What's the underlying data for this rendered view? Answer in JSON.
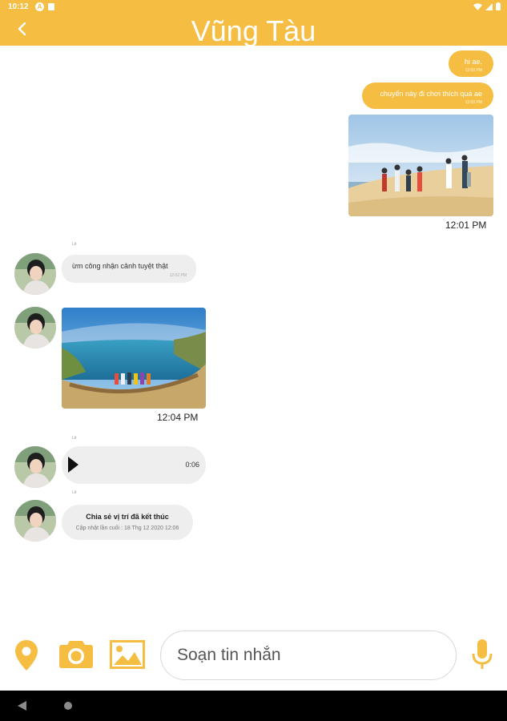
{
  "status_bar": {
    "time": "10:12",
    "left_icon_letter": "A"
  },
  "header": {
    "title": "Vũng Tàu",
    "background_color": "#f5bd41"
  },
  "messages": [
    {
      "type": "outgoing-text",
      "text": "hi ae.",
      "time": "12:00 PM"
    },
    {
      "type": "outgoing-text",
      "text": "chuyến này đi chơi thích quá ae",
      "time": "12:00 PM"
    },
    {
      "type": "outgoing-image",
      "image": "beach-group-photo",
      "time": "12:01 PM"
    },
    {
      "type": "incoming-text",
      "sender": "Lê",
      "text": "ừm công nhận cảnh tuyệt thật",
      "time": "12:02 PM"
    },
    {
      "type": "incoming-image",
      "sender": "",
      "image": "coastal-cliff-photo",
      "time": "12:04 PM"
    },
    {
      "type": "incoming-audio",
      "sender": "Lê",
      "duration": "0:06"
    },
    {
      "type": "incoming-location",
      "sender": "Lê",
      "title": "Chia sẻ vị trí đã kết thúc",
      "subtitle": "Cập nhật lần cuối : 18 Thg 12 2020 12:06"
    }
  ],
  "input_bar": {
    "placeholder": "Soạn tin nhắn",
    "icons": [
      "location-pin-icon",
      "camera-icon",
      "image-gallery-icon",
      "microphone-icon"
    ],
    "icon_color": "#f5bd41"
  }
}
